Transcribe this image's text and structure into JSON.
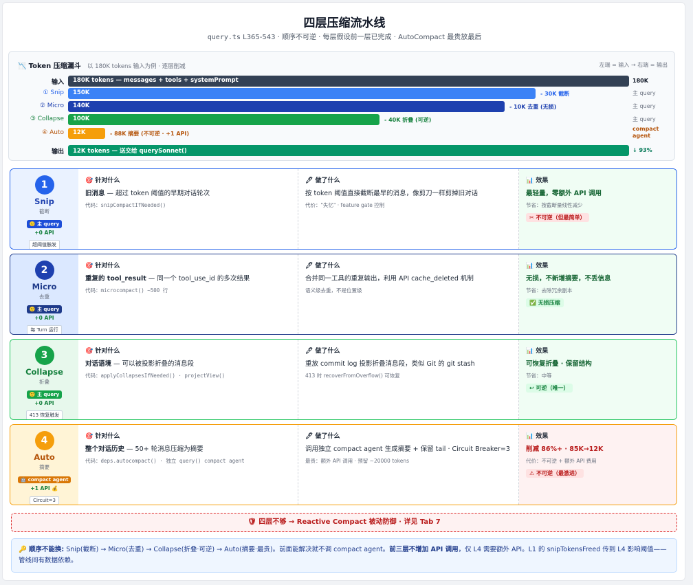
{
  "header": {
    "title": "四层压缩流水线",
    "subtitle_code": "query.ts",
    "subtitle_rest": " L365-543 · 顺序不可逆 · 每层假设前一层已完成 · AutoCompact 最贵放最后"
  },
  "funnel": {
    "icon": "📉",
    "title": "Token 压缩漏斗",
    "sub": "以 180K tokens 输入为例 · 逐层削减",
    "hint": "左端 = 输入 → 右端 = 输出",
    "input": {
      "label": "输入",
      "text": "180K tokens — messages + tools + systemPrompt",
      "right": "180K",
      "color": "#334155",
      "value_k": 180
    },
    "stages": [
      {
        "label": "① Snip",
        "bar": "150K",
        "note": "- 30K 截断",
        "right": "主 query",
        "color": "#3b82f6",
        "label_color": "#2563eb",
        "value_k": 150
      },
      {
        "label": "② Micro",
        "bar": "140K",
        "note": "- 10K 去重 (无损)",
        "right": "主 query",
        "color": "#1e40af",
        "label_color": "#1e40af",
        "value_k": 140
      },
      {
        "label": "③ Collapse",
        "bar": "100K",
        "note": "- 40K 折叠 (可逆)",
        "right": "主 query",
        "color": "#16a34a",
        "label_color": "#15803d",
        "value_k": 100
      },
      {
        "label": "④ Auto",
        "bar": "12K",
        "note": "- 88K 摘要 (不可逆 · +1 API)",
        "right": "compact agent",
        "color": "#f59e0b",
        "label_color": "#b45309",
        "value_k": 12
      }
    ],
    "output": {
      "label": "输出",
      "text": "12K tokens — 送交给 querySonnet()",
      "right": "↓ 93%",
      "color": "#059669"
    }
  },
  "cards": [
    {
      "num": "1",
      "name": "Snip",
      "sub": "截断",
      "badge": "🙂 主 query",
      "api": "+0 API",
      "tag": "超阈值触发",
      "theme": {
        "border": "#2563eb",
        "side": "#eaf2ff",
        "circle": "#2563eb",
        "name": "#1e40af",
        "badge": "#1d4ed8",
        "result_bg": "#f0fdf4"
      },
      "what_head": "🎯 针对什么",
      "what_strong": "旧消息",
      "what_rest": " — 超过 token 阈值的早期对话轮次",
      "what_meta": "代码：snipCompactIfNeeded()",
      "do_head": "🖊 做了什么",
      "do_main": "按 token 阈值直接截断最早的消息，像剪刀一样剪掉旧对话",
      "do_meta": "代价：\"失忆\" · feature gate 控制",
      "res_head": "📊 效果",
      "res_main": "最轻量，零额外 API 调用",
      "res_meta": "节省：按截断量线性减少",
      "res_chip": "✂ 不可逆（但最简单）",
      "chip_bg": "#fee2e2",
      "chip_color": "#b91c1c"
    },
    {
      "num": "2",
      "name": "Micro",
      "sub": "去重",
      "badge": "🙂 主 query",
      "api": "+0 API",
      "tag": "每 Turn 运行",
      "theme": {
        "border": "#1e3a8a",
        "side": "#dbe8ff",
        "circle": "#1e40af",
        "name": "#1e3a8a",
        "badge": "#1e3a8a",
        "result_bg": "#f0fdf4"
      },
      "what_head": "🎯 针对什么",
      "what_strong": "重复的 tool_result",
      "what_rest": " — 同一个 tool_use_id 的多次结果",
      "what_meta": "代码：microcompact() ~500 行",
      "do_head": "🖊 做了什么",
      "do_main": "合并同一工具的重复输出，利用 API cache_deleted 机制",
      "do_meta": "语义级去重，不是位置级",
      "res_head": "📊 效果",
      "res_main": "无损，不新增摘要，不丢信息",
      "res_meta": "节省：去除冗余副本",
      "res_chip": "✅ 无损压缩",
      "chip_bg": "#dcfce7",
      "chip_color": "#15803d"
    },
    {
      "num": "3",
      "name": "Collapse",
      "sub": "折叠",
      "badge": "🙂 主 query",
      "api": "+0 API",
      "tag": "413 恢复触发",
      "theme": {
        "border": "#22c55e",
        "side": "#e7f8ec",
        "circle": "#16a34a",
        "name": "#15803d",
        "badge": "#16a34a",
        "result_bg": "#f0fdf4"
      },
      "what_head": "🎯 针对什么",
      "what_strong": "对话语境",
      "what_rest": " — 可以被投影折叠的消息段",
      "what_meta": "代码：applyCollapsesIfNeeded() · projectView()",
      "do_head": "🖊 做了什么",
      "do_main": "重放 commit log 投影折叠消息段，类似 Git 的 git stash",
      "do_meta": "413 时 recoverFromOverflow() 可恢复",
      "res_head": "📊 效果",
      "res_main": "可恢复折叠 · 保留结构",
      "res_meta": "节省：中等",
      "res_chip": "↩ 可逆（唯一）",
      "chip_bg": "#dcfce7",
      "chip_color": "#15803d"
    },
    {
      "num": "4",
      "name": "Auto",
      "sub": "摘要",
      "badge": "🤖 compact agent",
      "api": "+1 API 💰",
      "tag": "Circuit=3",
      "theme": {
        "border": "#f59e0b",
        "side": "#fff4d6",
        "circle": "#f59e0b",
        "name": "#b45309",
        "badge": "#d97706",
        "result_bg": "#fef2f2"
      },
      "what_head": "🎯 针对什么",
      "what_strong": "整个对话历史",
      "what_rest": " — 50+ 轮消息压缩为摘要",
      "what_meta": "代码：deps.autocompact() · 独立 query() compact agent",
      "do_head": "🖊 做了什么",
      "do_main": "调用独立 compact agent 生成摘要 + 保留 tail · Circuit Breaker=3",
      "do_meta": "最贵：额外 API 调用 · 预留 ~20000 tokens",
      "res_head": "📊 效果",
      "res_main": "削减 86%+ · 85K→12K",
      "res_meta": "代价：不可逆 + 额外 API 费用",
      "res_chip": "⚠ 不可逆（最激进）",
      "chip_bg": "#fee2e2",
      "chip_color": "#b91c1c"
    }
  ],
  "warning": "🛡 四层不够 → Reactive Compact 被动防御 · 详见 Tab 7",
  "footer": {
    "icon": "🔑",
    "strong": "顺序不能换:",
    "text": " Snip(截断) → Micro(去重) → Collapse(折叠·可逆) → Auto(摘要·最贵)。前面能解决就不调 compact agent。",
    "strong2": "前三层不增加 API 调用",
    "text2": "，仅 L4 需要额外 API。L1 的 snipTokensFreed 传到 L4 影响阈值——管线间有数据依赖。"
  }
}
